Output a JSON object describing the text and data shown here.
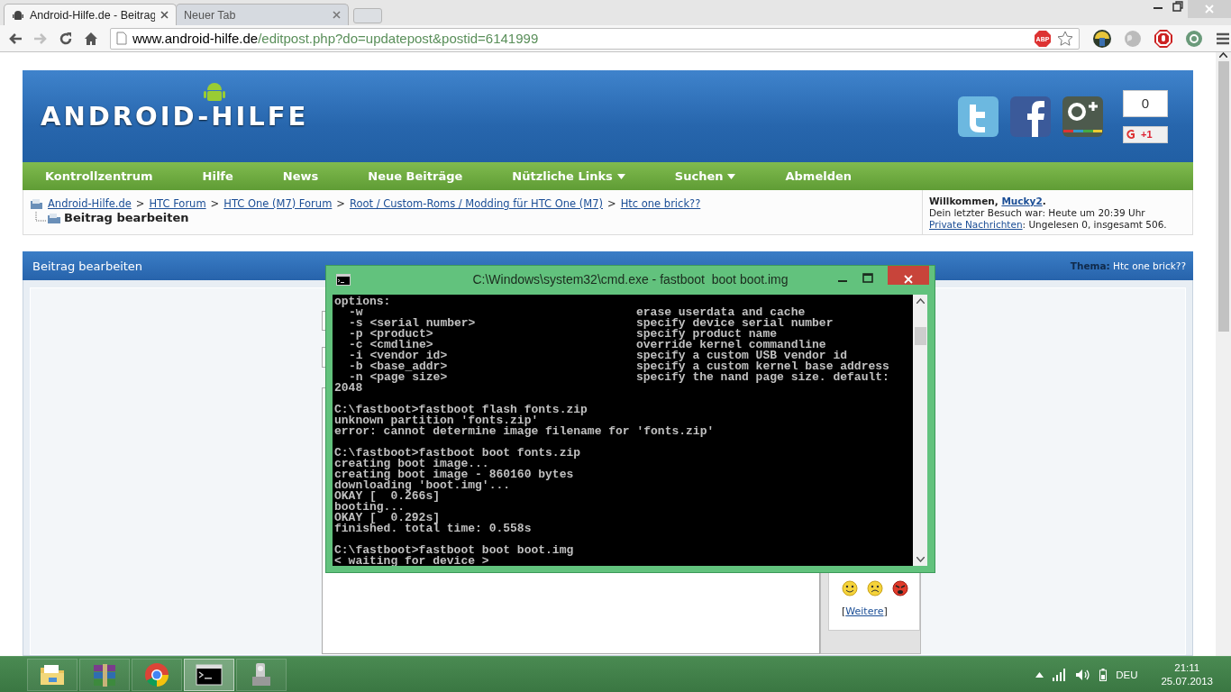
{
  "browser": {
    "tabs": [
      {
        "label": "Android-Hilfe.de - Beitrag",
        "selected": true
      },
      {
        "label": "Neuer Tab",
        "selected": false
      }
    ],
    "nav_buttons": [
      {
        "kind": "back",
        "disabled": false
      },
      {
        "kind": "forward",
        "disabled": true
      },
      {
        "kind": "reload",
        "disabled": false
      },
      {
        "kind": "home",
        "disabled": false
      }
    ],
    "url_host": "www.android-hilfe.de",
    "url_path": "/editpost.php?do=updatepost&postid=6141999",
    "adblock_label": "ABP"
  },
  "site": {
    "logo": "ANDROID-HILFE",
    "share_count": "0",
    "plus_one": "+1",
    "nav": [
      {
        "label": "Kontrollzentrum",
        "dropdown": false
      },
      {
        "label": "Hilfe",
        "dropdown": false
      },
      {
        "label": "News",
        "dropdown": false
      },
      {
        "label": "Neue Beiträge",
        "dropdown": false
      },
      {
        "label": "Nützliche Links",
        "dropdown": true
      },
      {
        "label": "Suchen",
        "dropdown": true
      },
      {
        "label": "Abmelden",
        "dropdown": false
      }
    ],
    "breadcrumb": [
      {
        "label": "Android-Hilfe.de",
        "separator": ">"
      },
      {
        "label": "HTC Forum",
        "separator": ">"
      },
      {
        "label": "HTC One (M7) Forum",
        "separator": ">"
      },
      {
        "label": "Root / Custom-Roms / Modding für HTC One (M7)",
        "separator": ">"
      },
      {
        "label": "Htc one brick??"
      }
    ],
    "current_page": "Beitrag bearbeiten",
    "welcome": {
      "greeting": "Willkommen, ",
      "username": "Mucky2",
      "greeting_end": ".",
      "last_visit": "Dein letzter Besuch war: Heute um 20:39 Uhr",
      "messages_link": "Private Nachrichten",
      "messages_text": ": Ungelesen 0, insgesamt 506."
    },
    "panel": {
      "title": "Beitrag bearbeiten",
      "thema": "**Thema:** Htc one brick??",
      "more_before": "[",
      "more_link": "Weitere",
      "more_after": "]"
    }
  },
  "cmd": {
    "title": "C:\\Windows\\system32\\cmd.exe - fastboot  boot boot.img",
    "header": "options:",
    "options": [
      {
        "flag": "-w",
        "description": "erase userdata and cache"
      },
      {
        "flag": "-s <serial number>",
        "description": "specify device serial number"
      },
      {
        "flag": "-p <product>",
        "description": "specify product name"
      },
      {
        "flag": "-c <cmdline>",
        "description": "override kernel commandline"
      },
      {
        "flag": "-i <vendor id>",
        "description": "specify a custom USB vendor id"
      },
      {
        "flag": "-b <base_addr>",
        "description": "specify a custom kernel base address"
      },
      {
        "flag": "-n <page size>",
        "description": "specify the nand page size. default:"
      }
    ],
    "wrapped": "2048",
    "blocks": [
      [
        "C:\\fastboot>fastboot flash fonts.zip",
        "unknown partition 'fonts.zip'",
        "error: cannot determine image filename for 'fonts.zip'"
      ],
      [
        "C:\\fastboot>fastboot boot fonts.zip",
        "creating boot image...",
        "creating boot image - 860160 bytes",
        "downloading 'boot.img'...",
        "OKAY [  0.266s]",
        "booting...",
        "OKAY [  0.292s]",
        "finished. total time: 0.558s"
      ],
      [
        "C:\\fastboot>fastboot boot boot.img",
        "< waiting for device >"
      ]
    ]
  },
  "taskbar": {
    "apps": [
      {
        "kind": "explorer",
        "selected": false
      },
      {
        "kind": "archive",
        "selected": false
      },
      {
        "kind": "browser",
        "selected": false
      },
      {
        "kind": "console",
        "selected": true
      },
      {
        "kind": "installer",
        "selected": false
      }
    ],
    "language": "DEU",
    "time": "21:11",
    "date": "25.07.2013"
  }
}
